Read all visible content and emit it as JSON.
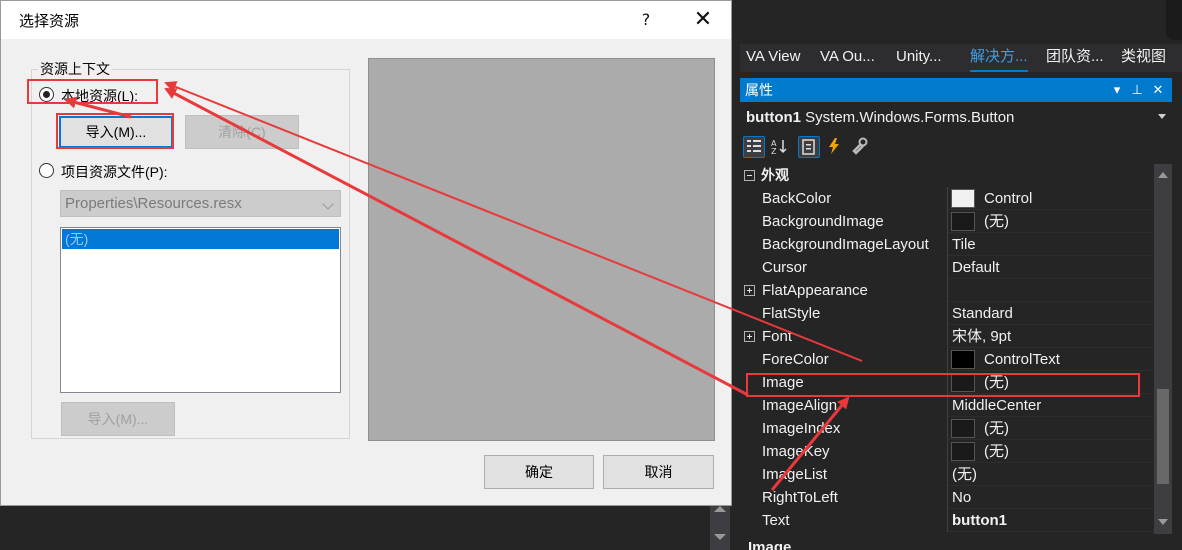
{
  "ide": {
    "tabs": [
      "VA View",
      "VA Ou...",
      "Unity...",
      "解决方...",
      "团队资...",
      "类视图"
    ],
    "active_tab_index": 3,
    "properties": {
      "title": "属性",
      "title_buttons": [
        "▾",
        "⊥",
        "✕"
      ],
      "object_name": "button1",
      "object_type": "System.Windows.Forms.Button",
      "category": "外观",
      "rows": [
        {
          "name": "BackColor",
          "value": "Control",
          "swatch": "#f0f0f0"
        },
        {
          "name": "BackgroundImage",
          "value": "(无)",
          "swatch": "#1a1a1a"
        },
        {
          "name": "BackgroundImageLayout",
          "value": "Tile"
        },
        {
          "name": "Cursor",
          "value": "Default"
        },
        {
          "name": "FlatAppearance",
          "value": "",
          "expandable": true
        },
        {
          "name": "FlatStyle",
          "value": "Standard"
        },
        {
          "name": "Font",
          "value": "宋体, 9pt",
          "expandable": true
        },
        {
          "name": "ForeColor",
          "value": "ControlText",
          "swatch": "#000000"
        },
        {
          "name": "Image",
          "value": "(无)",
          "swatch": "#1a1a1a"
        },
        {
          "name": "ImageAlign",
          "value": "MiddleCenter"
        },
        {
          "name": "ImageIndex",
          "value": "(无)",
          "swatch": "#1a1a1a"
        },
        {
          "name": "ImageKey",
          "value": "(无)",
          "swatch": "#1a1a1a"
        },
        {
          "name": "ImageList",
          "value": "(无)"
        },
        {
          "name": "RightToLeft",
          "value": "No"
        },
        {
          "name": "Text",
          "value": "button1",
          "bold": true
        }
      ],
      "description_title": "Image"
    }
  },
  "dialog": {
    "title": "选择资源",
    "help_glyph": "?",
    "close_glyph": "✕",
    "group_label": "资源上下文",
    "local_radio": "本地资源(L):",
    "import_button": "导入(M)...",
    "clear_button": "清除(C)",
    "project_radio": "项目资源文件(P):",
    "resource_file": "Properties\\Resources.resx",
    "list_items": [
      "(无)"
    ],
    "import_button_2": "导入(M)...",
    "ok_button": "确定",
    "cancel_button": "取消"
  },
  "colors": {
    "accent": "#007acc",
    "annotation": "#e8393b"
  }
}
